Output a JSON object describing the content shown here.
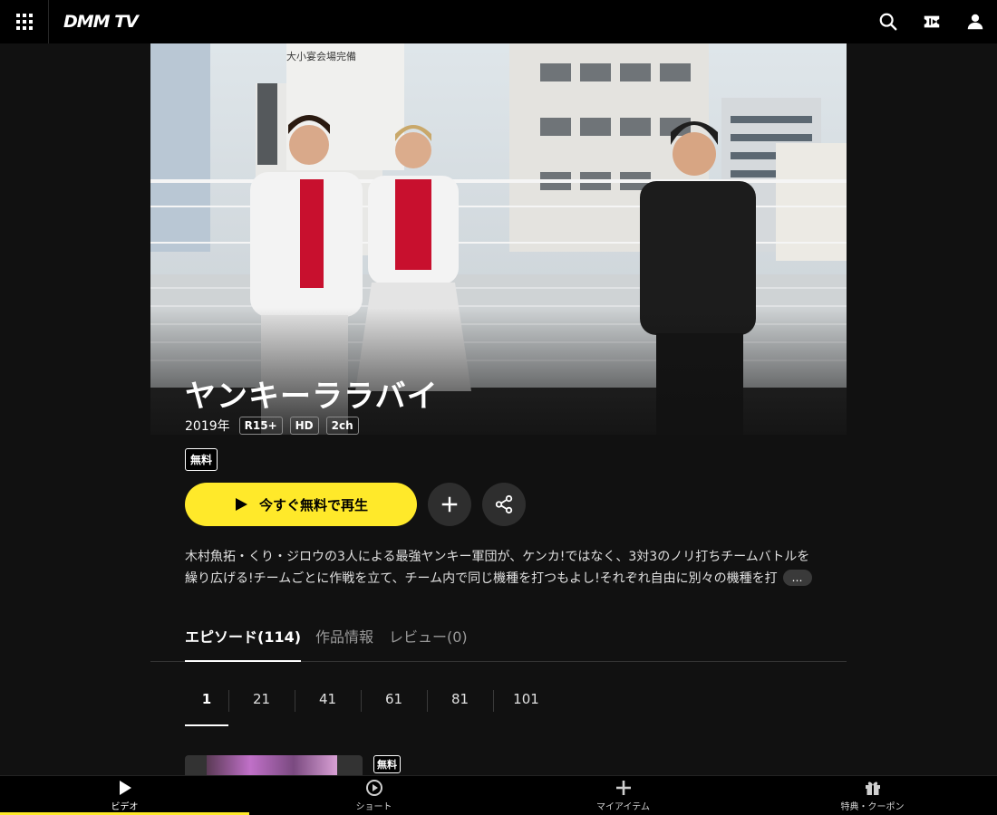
{
  "header": {
    "logo": "DMM TV",
    "icons": [
      "grid-menu-icon",
      "search-icon",
      "ticket-icon",
      "user-icon"
    ]
  },
  "hero": {
    "signboard": "大小宴会場完備"
  },
  "title": "ヤンキーララバイ",
  "meta": {
    "year": "2019年",
    "tags": [
      "R15+",
      "HD",
      "2ch"
    ]
  },
  "free_badge": "無料",
  "actions": {
    "play_label": "今すぐ無料で再生",
    "add_icon": "plus-icon",
    "share_icon": "share-icon"
  },
  "description": {
    "line1": "木村魚拓・くり・ジロウの3人による最強ヤンキー軍団が、ケンカ!ではなく、3対3のノリ打ちチームバトルを",
    "line2": "繰り広げる!チームごとに作戦を立て、チーム内で同じ機種を打つもよし!それぞれ自由に別々の機種を打",
    "more_label": "…"
  },
  "tabs": [
    {
      "label": "エピソード(114)",
      "active": true
    },
    {
      "label": "作品情報",
      "active": false
    },
    {
      "label": "レビュー(0)",
      "active": false
    }
  ],
  "pager": [
    "1",
    "21",
    "41",
    "61",
    "81",
    "101"
  ],
  "episode": {
    "free_badge": "無料"
  },
  "bottom_nav": [
    {
      "label": "ビデオ",
      "icon": "play-icon",
      "active": true
    },
    {
      "label": "ショート",
      "icon": "short-play-icon",
      "active": false
    },
    {
      "label": "マイアイテム",
      "icon": "plus-icon",
      "active": false
    },
    {
      "label": "特典・クーポン",
      "icon": "gift-icon",
      "active": false
    }
  ],
  "colors": {
    "accent": "#ffe92a",
    "background": "#111111",
    "header": "#000000"
  }
}
